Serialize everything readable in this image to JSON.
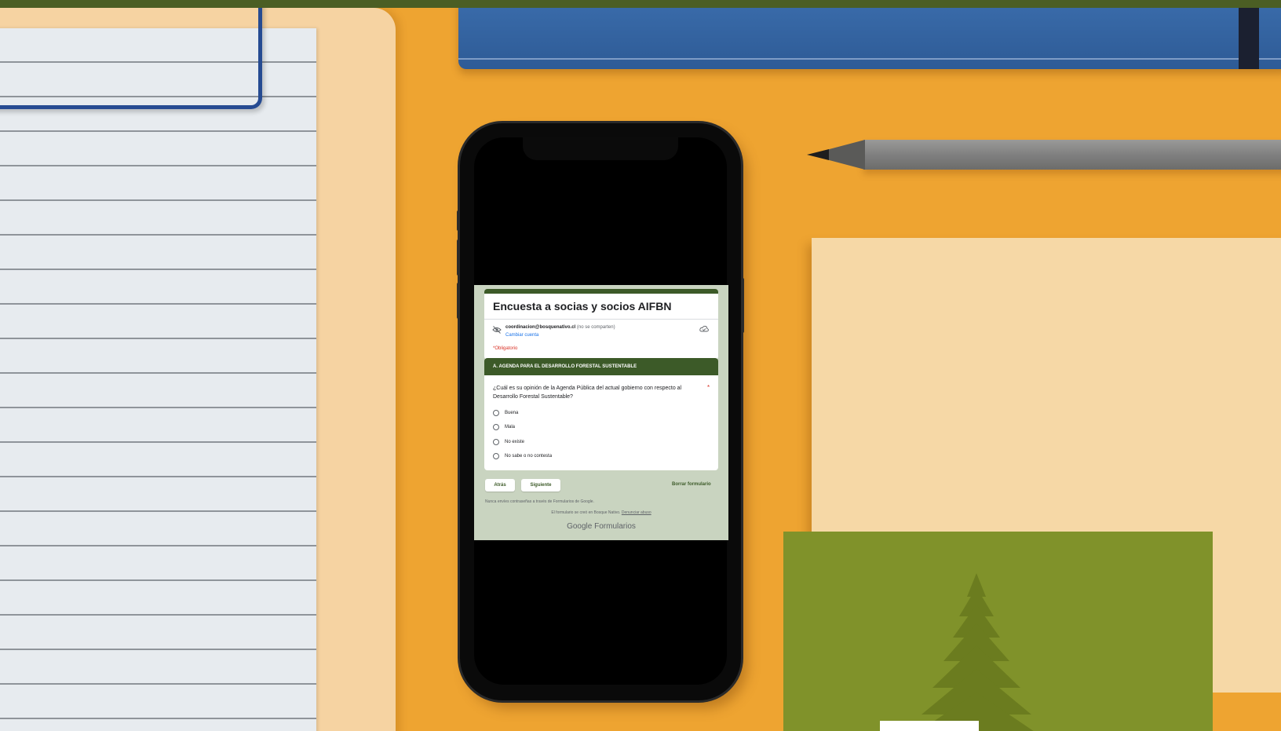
{
  "form": {
    "title": "Encuesta a socias y socios AIFBN",
    "account_email": "coordinacion@bosquenativo.cl",
    "account_note": "(no se comparten)",
    "switch_account": "Cambiar cuenta",
    "required_note": "*Obligatorio",
    "section_title": "A.    AGENDA PARA EL DESARROLLO FORESTAL SUSTENTABLE",
    "question": "¿Cuál es su opinión de la Agenda Pública del actual gobierno con respecto al Desarrollo Forestal Sustentable?",
    "required_mark": "*",
    "options": [
      "Buena",
      "Mala",
      "No existe",
      "No sabe o no contesta"
    ],
    "back_label": "Atrás",
    "next_label": "Siguiente",
    "clear_label": "Borrar formulario",
    "password_warning": "Nunca envíes contraseñas a través de Formularios de Google.",
    "origin_text": "El formulario se creó en Bosque Nativo.",
    "report_abuse": "Denunciar abuso",
    "brand": "Google Formularios",
    "theme_color": "#3c5a28",
    "background_color": "#c9d4c0"
  },
  "icons": {
    "privacy": "eye-off-icon",
    "cloud": "cloud-saved-icon",
    "tree": "conifer-tree-icon"
  },
  "colors": {
    "desk": "#eea431",
    "tile": "#80922a",
    "notebook": "#2e5b96"
  }
}
